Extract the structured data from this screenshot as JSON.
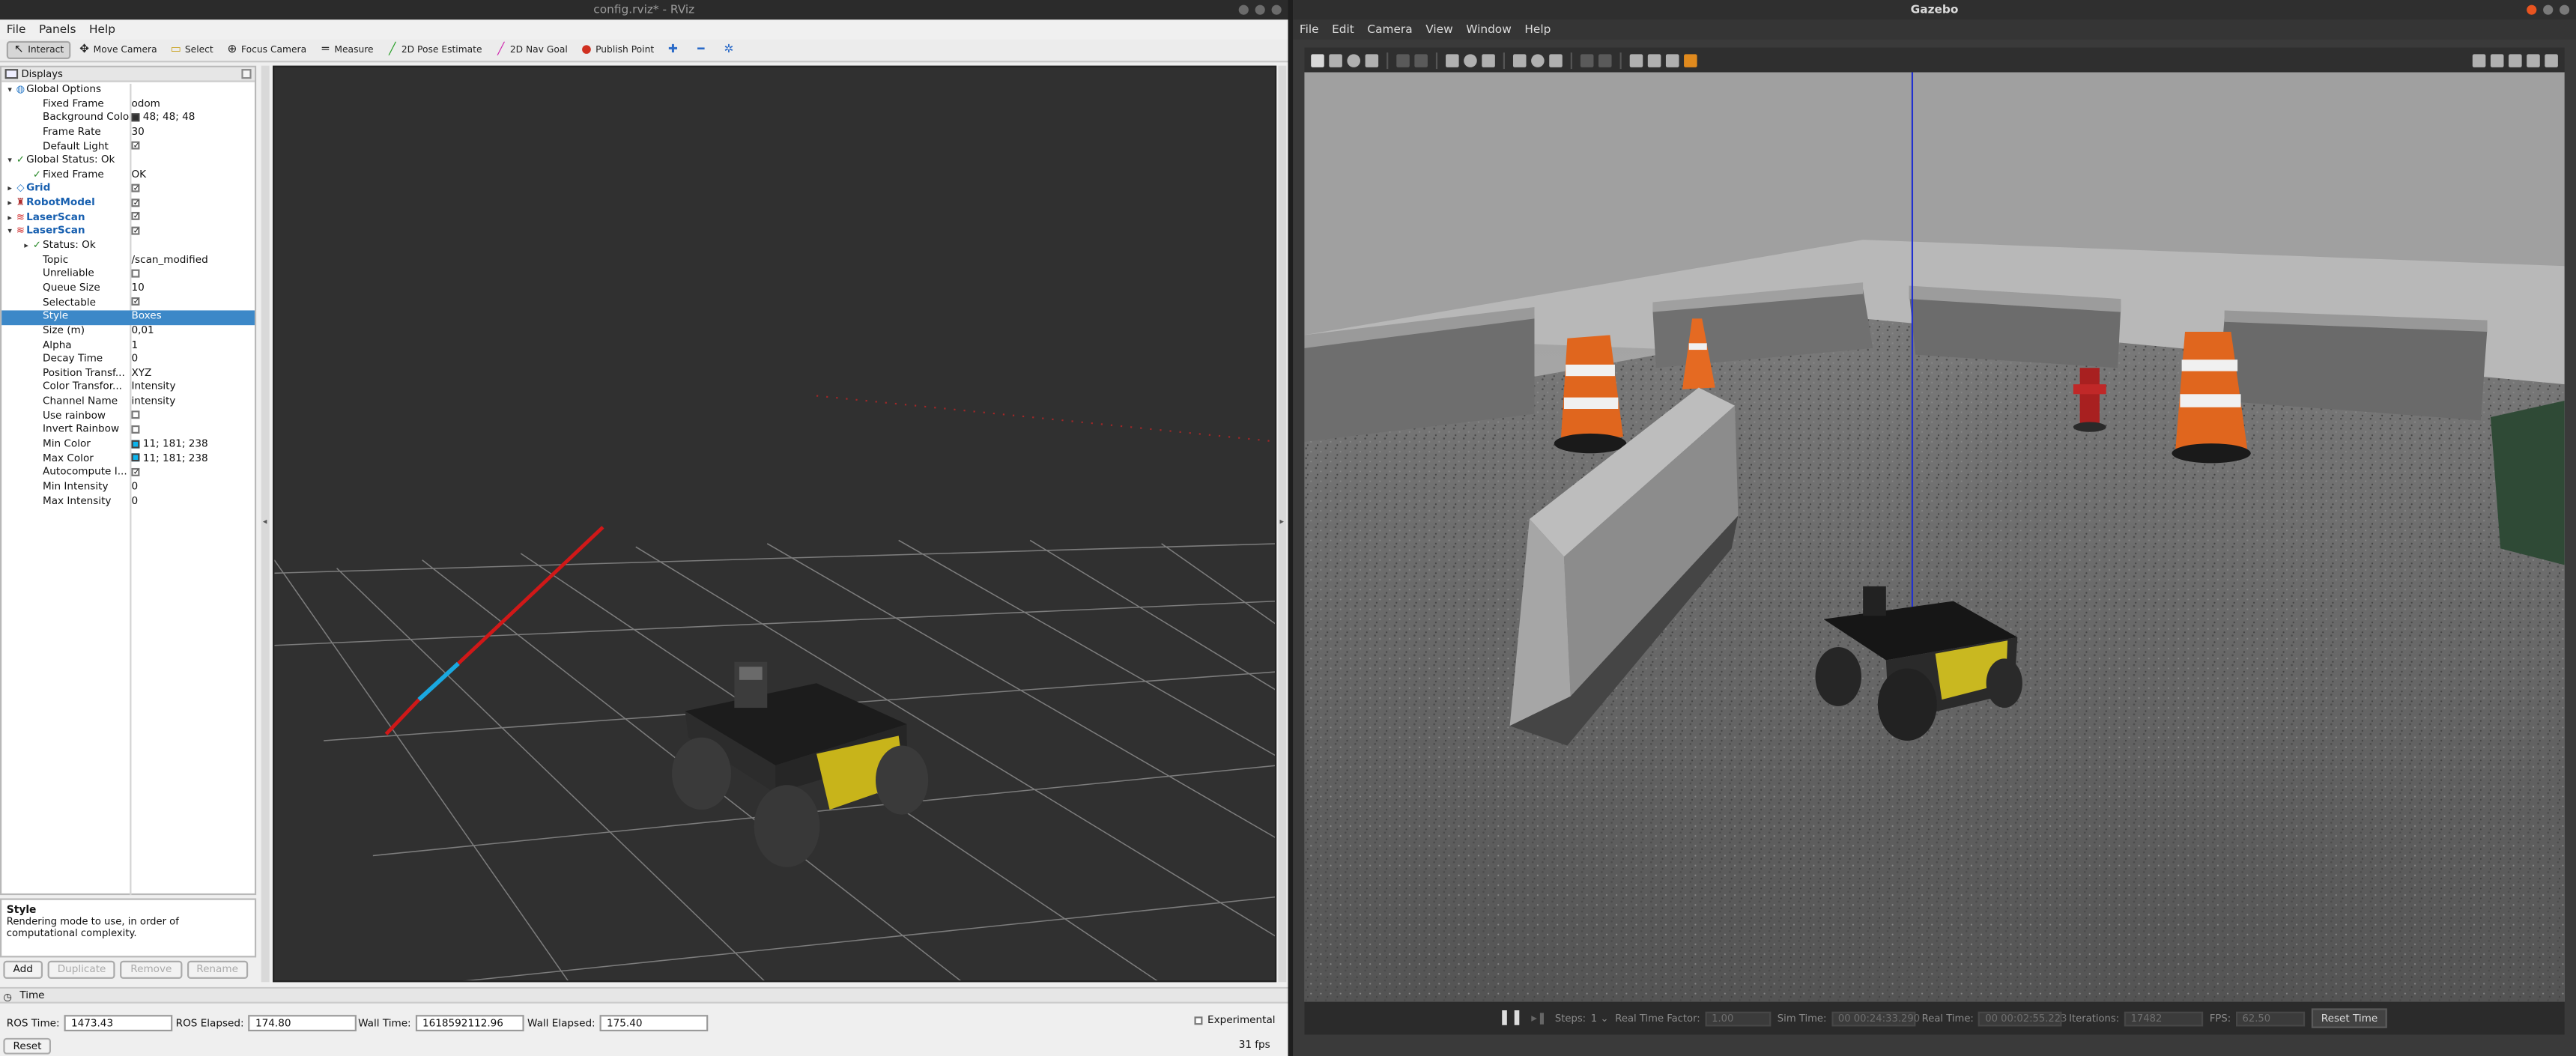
{
  "rviz": {
    "title": "config.rviz* - RViz",
    "menu": [
      "File",
      "Panels",
      "Help"
    ],
    "toolbar": [
      {
        "label": "Interact",
        "icon": "interact-icon",
        "active": true
      },
      {
        "label": "Move Camera",
        "icon": "move-camera-icon"
      },
      {
        "label": "Select",
        "icon": "select-icon"
      },
      {
        "label": "Focus Camera",
        "icon": "focus-camera-icon"
      },
      {
        "label": "Measure",
        "icon": "measure-icon"
      },
      {
        "label": "2D Pose Estimate",
        "icon": "pose-estimate-icon"
      },
      {
        "label": "2D Nav Goal",
        "icon": "nav-goal-icon"
      },
      {
        "label": "Publish Point",
        "icon": "publish-point-icon"
      }
    ],
    "displays_title": "Displays",
    "tree": [
      {
        "label": "Global Options",
        "value": "",
        "depth": 0,
        "arrow": "down",
        "icon": "globe-icon"
      },
      {
        "label": "Fixed Frame",
        "value": "odom",
        "depth": 1
      },
      {
        "label": "Background Color",
        "value": "48; 48; 48",
        "depth": 1,
        "swatch": "#303030"
      },
      {
        "label": "Frame Rate",
        "value": "30",
        "depth": 1
      },
      {
        "label": "Default Light",
        "value": "",
        "depth": 1,
        "check": true
      },
      {
        "label": "Global Status: Ok",
        "value": "",
        "depth": 0,
        "arrow": "down",
        "icon": "checkmark-icon"
      },
      {
        "label": "Fixed Frame",
        "value": "OK",
        "depth": 1,
        "icon": "checkmark-icon"
      },
      {
        "label": "Grid",
        "value": "",
        "depth": 0,
        "arrow": "right",
        "icon": "grid-icon",
        "blue": true,
        "check": true
      },
      {
        "label": "RobotModel",
        "value": "",
        "depth": 0,
        "arrow": "right",
        "icon": "robot-model-icon",
        "blue": true,
        "check": true
      },
      {
        "label": "LaserScan",
        "value": "",
        "depth": 0,
        "arrow": "right",
        "icon": "laser-scan-icon",
        "blue": true,
        "check": true
      },
      {
        "label": "LaserScan",
        "value": "",
        "depth": 0,
        "arrow": "down",
        "icon": "laser-scan-icon",
        "blue": true,
        "check": true
      },
      {
        "label": "Status: Ok",
        "value": "",
        "depth": 1,
        "arrow": "right",
        "icon": "checkmark-icon"
      },
      {
        "label": "Topic",
        "value": "/scan_modified",
        "depth": 1
      },
      {
        "label": "Unreliable",
        "value": "",
        "depth": 1,
        "check": false
      },
      {
        "label": "Queue Size",
        "value": "10",
        "depth": 1
      },
      {
        "label": "Selectable",
        "value": "",
        "depth": 1,
        "check": true
      },
      {
        "label": "Style",
        "value": "Boxes",
        "depth": 1,
        "selected": true
      },
      {
        "label": "Size (m)",
        "value": "0,01",
        "depth": 1
      },
      {
        "label": "Alpha",
        "value": "1",
        "depth": 1
      },
      {
        "label": "Decay Time",
        "value": "0",
        "depth": 1
      },
      {
        "label": "Position Transf...",
        "value": "XYZ",
        "depth": 1
      },
      {
        "label": "Color Transfor...",
        "value": "Intensity",
        "depth": 1
      },
      {
        "label": "Channel Name",
        "value": "intensity",
        "depth": 1
      },
      {
        "label": "Use rainbow",
        "value": "",
        "depth": 1,
        "check": false
      },
      {
        "label": "Invert Rainbow",
        "value": "",
        "depth": 1,
        "check": false
      },
      {
        "label": "Min Color",
        "value": "11; 181; 238",
        "depth": 1,
        "swatch": "#0bb5ee"
      },
      {
        "label": "Max Color",
        "value": "11; 181; 238",
        "depth": 1,
        "swatch": "#0bb5ee"
      },
      {
        "label": "Autocompute I...",
        "value": "",
        "depth": 1,
        "check": true
      },
      {
        "label": "Min Intensity",
        "value": "0",
        "depth": 1
      },
      {
        "label": "Max Intensity",
        "value": "0",
        "depth": 1
      }
    ],
    "description": {
      "title": "Style",
      "text": "Rendering mode to use, in order of computational complexity."
    },
    "buttons": {
      "add": "Add",
      "duplicate": "Duplicate",
      "remove": "Remove",
      "rename": "Rename"
    },
    "time": {
      "title": "Time",
      "ros_time_label": "ROS Time:",
      "ros_time": "1473.43",
      "ros_elapsed_label": "ROS Elapsed:",
      "ros_elapsed": "174.80",
      "wall_time_label": "Wall Time:",
      "wall_time": "1618592112.96",
      "wall_elapsed_label": "Wall Elapsed:",
      "wall_elapsed": "175.40",
      "experimental_label": "Experimental",
      "reset_label": "Reset",
      "fps": "31 fps"
    }
  },
  "gazebo": {
    "title": "Gazebo",
    "menu": [
      "File",
      "Edit",
      "Camera",
      "View",
      "Window",
      "Help"
    ],
    "status": {
      "steps_label": "Steps:",
      "steps": "1",
      "rtf_label": "Real Time Factor:",
      "rtf": "1.00",
      "sim_time_label": "Sim Time:",
      "sim_time": "00 00:24:33.290",
      "real_time_label": "Real Time:",
      "real_time": "00 00:02:55.223",
      "iterations_label": "Iterations:",
      "iterations": "17482",
      "fps_label": "FPS:",
      "fps": "62.50",
      "reset_time_label": "Reset Time"
    }
  }
}
